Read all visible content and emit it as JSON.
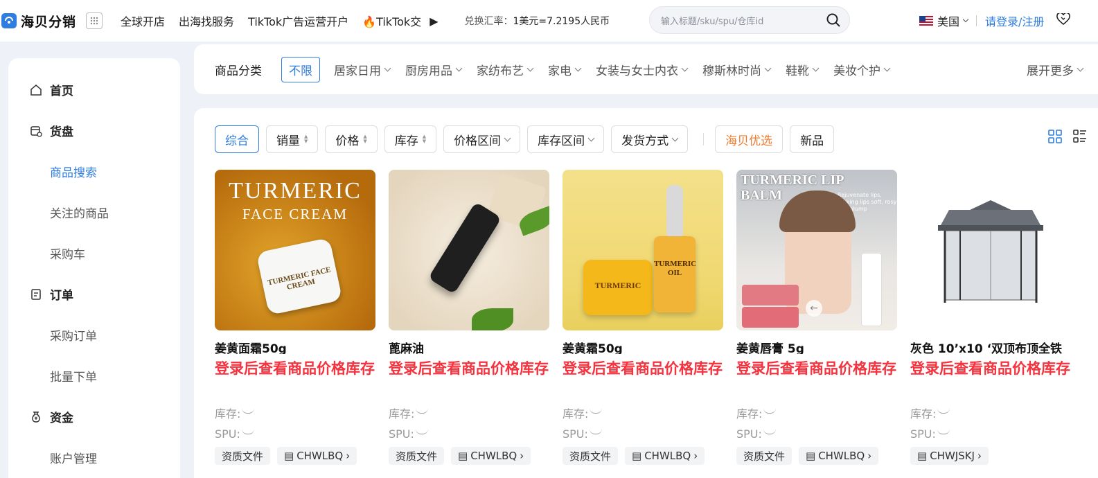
{
  "header": {
    "logo_text": "海贝分销",
    "nav": [
      "全球开店",
      "出海找服务",
      "TikTok广告运营开户",
      "TikTok交"
    ],
    "exchange_rate_label": "兑换汇率：",
    "exchange_rate_value": "1美元=7.2195人民币",
    "search_placeholder": "输入标题/sku/spu/仓库id",
    "region": "美国",
    "login": "请登录/注册"
  },
  "sidebar": {
    "sections": [
      {
        "label": "首页",
        "icon": "home-icon"
      },
      {
        "label": "货盘",
        "icon": "inventory-icon",
        "items": [
          "商品搜索",
          "关注的商品",
          "采购车"
        ],
        "active": "商品搜索"
      },
      {
        "label": "订单",
        "icon": "order-icon",
        "items": [
          "采购订单",
          "批量下单"
        ]
      },
      {
        "label": "资金",
        "icon": "money-bag-icon",
        "items": [
          "账户管理"
        ]
      }
    ]
  },
  "categories": {
    "title": "商品分类",
    "selected": "不限",
    "items": [
      "居家日用",
      "厨房用品",
      "家纺布艺",
      "家电",
      "女装与女士内衣",
      "穆斯林时尚",
      "鞋靴",
      "美妆个护"
    ],
    "more": "展开更多"
  },
  "filters": {
    "overall": "综合",
    "sales": "销量",
    "price": "价格",
    "stock": "库存",
    "price_range": "价格区间",
    "stock_range": "库存区间",
    "shipping": "发货方式",
    "featured": "海贝优选",
    "new": "新品"
  },
  "products": [
    {
      "name": "姜黄面霜50g",
      "price_text": "登录后查看商品价格库存",
      "stock_label": "库存:",
      "spu_label": "SPU:",
      "tag_doc": "资质文件",
      "warehouse": "CHWLBQ",
      "image_title": "TURMERIC",
      "image_subtitle": "FACE CREAM",
      "image_jar_label": "TURMERIC FACE CREAM"
    },
    {
      "name": "蓖麻油",
      "price_text": "登录后查看商品价格库存",
      "stock_label": "库存:",
      "spu_label": "SPU:",
      "tag_doc": "资质文件",
      "warehouse": "CHWLBQ"
    },
    {
      "name": "姜黄霜50g",
      "price_text": "登录后查看商品价格库存",
      "stock_label": "库存:",
      "spu_label": "SPU:",
      "tag_doc": "资质文件",
      "warehouse": "CHWLBQ",
      "image_jar_label": "TURMERIC",
      "image_bottle_label": "TURMERIC OIL"
    },
    {
      "name": "姜黄唇膏 5g",
      "price_text": "登录后查看商品价格库存",
      "stock_label": "库存:",
      "spu_label": "SPU:",
      "tag_doc": "资质文件",
      "warehouse": "CHWLBQ",
      "image_title": "TURMERIC LIP",
      "image_subtitle": "BALM",
      "image_caption": "Rejuvenate lips, making lips soft, rosy and plump"
    },
    {
      "name": "灰色 10’x10 ‘双顶布顶全铁",
      "price_text": "登录后查看商品价格库存",
      "stock_label": "库存:",
      "spu_label": "SPU:",
      "warehouse": "CHWJSKJ"
    }
  ],
  "colors": {
    "accent": "#2f7de1",
    "price": "#f5333f",
    "featured": "#f07a2d"
  }
}
